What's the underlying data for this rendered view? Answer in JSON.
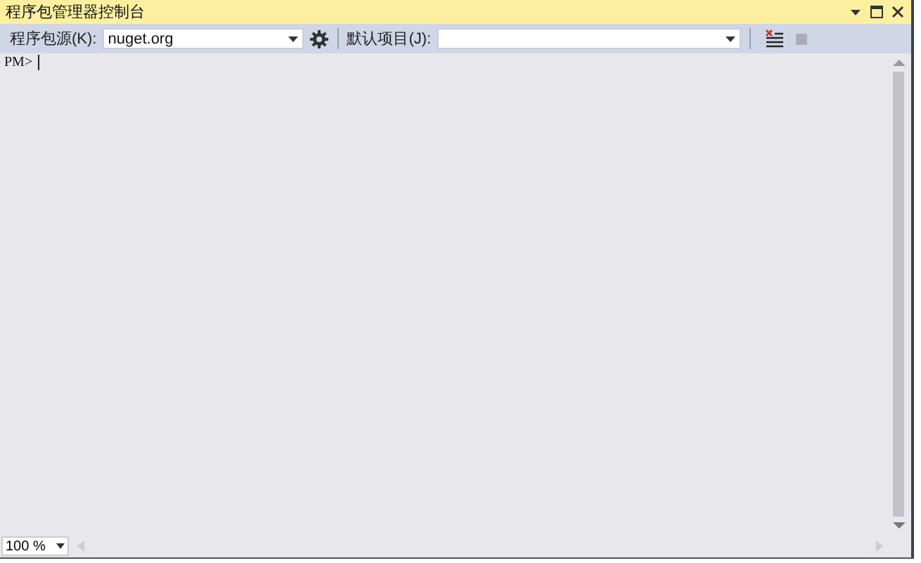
{
  "window": {
    "title": "程序包管理器控制台"
  },
  "toolbar": {
    "source_label": "程序包源(K):",
    "source_value": "nuget.org",
    "project_label": "默认项目(J):"
  },
  "console": {
    "prompt": "PM>"
  },
  "status_bar": {
    "zoom": "100 %"
  }
}
